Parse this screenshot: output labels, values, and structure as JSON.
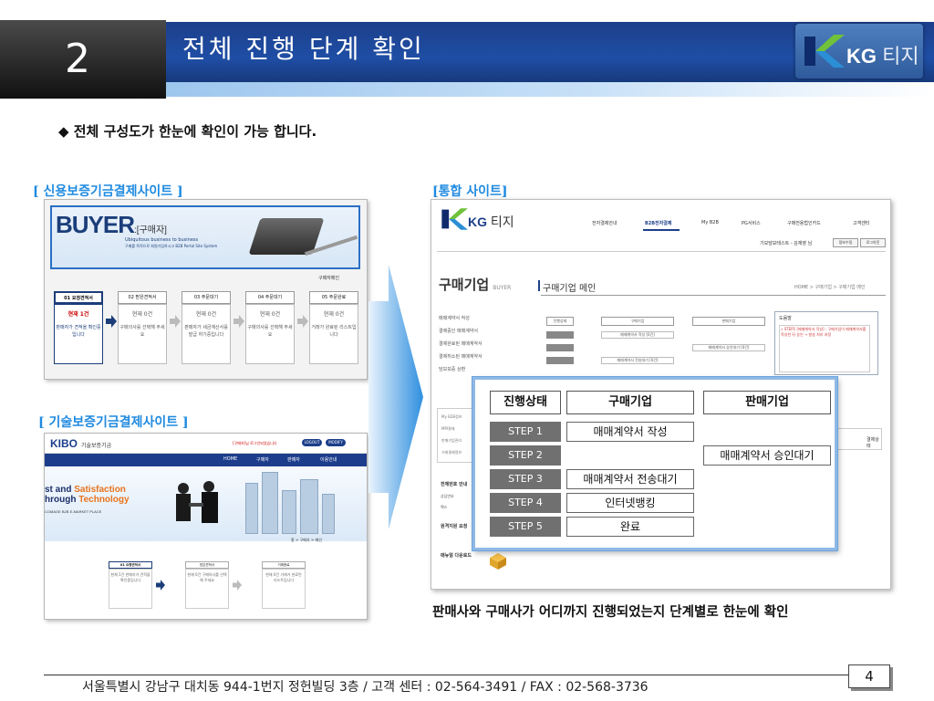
{
  "header": {
    "number": "2",
    "title": "전체 진행 단계 확인",
    "logo_brand": "KG",
    "logo_suffix": "티지"
  },
  "intro": "◆ 전체 구성도가 한눈에 확인이 가능 합니다.",
  "sections": {
    "credit_site_label": "[ 신용보증기금결제사이트 ]",
    "tech_site_label": "[ 기술보증기금결제사이트 ]",
    "integrated_site_label": "[통합 사이트]"
  },
  "credit_site": {
    "buyer": "BUYER",
    "buyer_tag": ":[구매자]",
    "tagline1": "Ubiquitous business to business",
    "tagline2": "구매를 목적으로 회원가입하시고 B2B Portal Site System",
    "link": "구매자메인",
    "steps": [
      {
        "tab": "01 요청견적서",
        "count": "현재 1건",
        "desc": "판매자가 견적을 확인중입니다"
      },
      {
        "tab": "02 받은견적서",
        "count": "현재 0건",
        "desc": "구매의사를 선택해 주세요"
      },
      {
        "tab": "03 주문대기",
        "count": "현재 0건",
        "desc": "판매자가 세금계산서를 발급 하기중입니다"
      },
      {
        "tab": "04 주문대기",
        "count": "현재 0건",
        "desc": "구매의사를 선택해 주세요"
      },
      {
        "tab": "05 주문완료",
        "count": "현재 0건",
        "desc": "거래가 완료된 리스트입니다"
      }
    ]
  },
  "tech_site": {
    "logo": "KIBO",
    "logo_sub": "기술보증기금",
    "message": "[구매자]님 로그인되었습니다",
    "btn1": "LOGOUT",
    "btn2": "MODIFY",
    "nav": [
      "HOME",
      "구매자",
      "판매자",
      "이용안내"
    ],
    "hero_line1a": "st and ",
    "hero_line1b": "Satisfaction",
    "hero_line2a": "hrough ",
    "hero_line2b": "Technology",
    "hero_sub": "COMAGE B2B E-MARKET PLACE",
    "crumb": "홈 > 구매자 > 메인",
    "steps": [
      {
        "tab": "01 요청견적서",
        "text": "현재 1건 판매자가 견적을 확인중입니다"
      },
      {
        "tab": "받은견적서",
        "text": "현재 0건 구매의사를 선택해 주세요"
      },
      {
        "tab": "거래종료",
        "text": "현재 0건 거래가 완료된 리스트입니다"
      }
    ]
  },
  "integrated": {
    "logo_brand": "KG",
    "logo_suffix": "티지",
    "nav": [
      "전자결제안내",
      "B2B전자결제",
      "My B2B",
      "PG서비스",
      "구매전용법인카드",
      "고객센터"
    ],
    "user": "기보담보테스트 - 김재영 님",
    "btn_info": "정보수정",
    "btn_logout": "로그아웃",
    "title": "구매기업",
    "title_en": "BUYER",
    "subtitle": "구매기업 메인",
    "crumb": "HOME > 구매기업 > 구매기업 메인",
    "side_menu": [
      "매매계약서 작성",
      "결제중인 매매계약서",
      "결제완료된 매매계약서",
      "결제취소된 매매계약서",
      "담보보증 상환"
    ],
    "mini_headers": [
      "진행상태",
      "구매기업",
      "판매기업"
    ],
    "mini_rows": [
      "매매계약서 작성 [0건]",
      "매매계약서 승인대기 [0건]",
      "매매계약서 전송대기 [0건]"
    ],
    "help_title": "도움말",
    "help_text": "» STEP1 [매매계약서 작성] : 구매기업이 매매계약서를 작성한 뒤 승인 → 발송 처리 과정",
    "left_links": [
      "My B2B정보",
      "MPI결제",
      "판매기업관리",
      "거래결제정보"
    ],
    "stats": [
      {
        "label": "전체번호 안내",
        "value": "0"
      },
      {
        "label": "상담번호",
        "value": "0"
      },
      {
        "label": "팩스",
        "value": "0"
      }
    ],
    "support": "원격지원 요청",
    "manual": "매뉴얼 다운로드",
    "right_col": "결제상태"
  },
  "zoom_table": {
    "headers": [
      "진행상태",
      "구매기업",
      "판매기업"
    ],
    "rows": [
      {
        "step": "STEP 1",
        "buyer": "매매계약서 작성",
        "seller": ""
      },
      {
        "step": "STEP 2",
        "buyer": "",
        "seller": "매매계약서 승인대기"
      },
      {
        "step": "STEP 3",
        "buyer": "매매계약서 전송대기",
        "seller": ""
      },
      {
        "step": "STEP 4",
        "buyer": "인터넷뱅킹",
        "seller": ""
      },
      {
        "step": "STEP 5",
        "buyer": "완료",
        "seller": ""
      }
    ]
  },
  "caption": "판매사와 구매사가 어디까지 진행되었는지 단계별로 한눈에 확인",
  "footer": {
    "address": "서울특별시 강남구 대치동 944-1번지 정헌빌딩 3층  /  고객 센터 : 02-564-3491  /   FAX : 02-568-3736",
    "page": "4"
  },
  "colors": {
    "header_blue": "#1f4ea5",
    "label_blue": "#1f8ae0",
    "step_gray": "#707070"
  }
}
